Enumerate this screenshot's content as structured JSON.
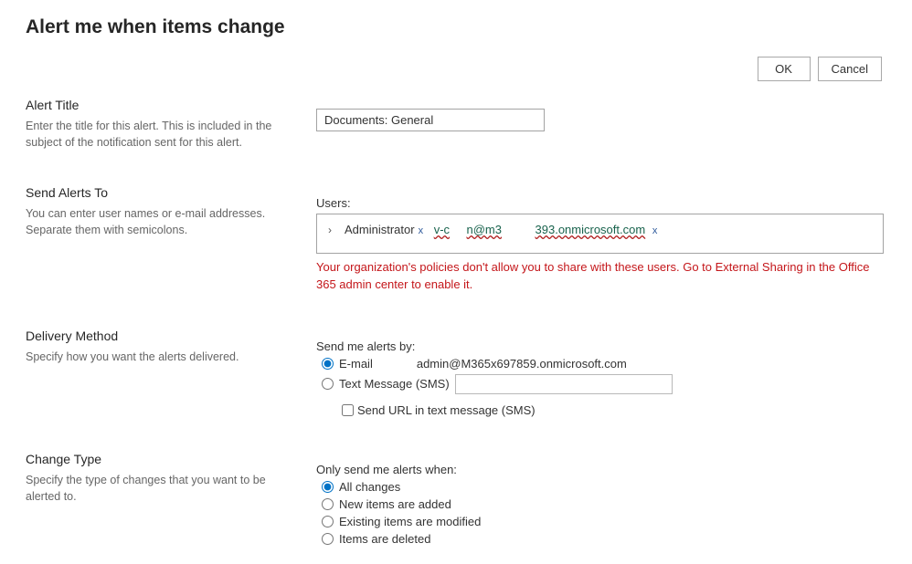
{
  "pageTitle": "Alert me when items change",
  "actions": {
    "ok": "OK",
    "cancel": "Cancel"
  },
  "alertTitle": {
    "heading": "Alert Title",
    "desc": "Enter the title for this alert. This is included in the subject of the notification sent for this alert.",
    "value": "Documents: General"
  },
  "sendAlertsTo": {
    "heading": "Send Alerts To",
    "desc": "You can enter user names or e-mail addresses. Separate them with semicolons.",
    "usersLabel": "Users:",
    "tokens": [
      {
        "text": "Administrator",
        "underlined": false
      },
      {
        "text": "v-c",
        "underlined": true
      },
      {
        "text": "n@m3",
        "underlined": true
      },
      {
        "text": "393.onmicrosoft.com",
        "underlined": true
      }
    ],
    "remove": "x",
    "error": "Your organization's policies don't allow you to share with these users. Go to External Sharing in the Office 365 admin center to enable it."
  },
  "delivery": {
    "heading": "Delivery Method",
    "desc": "Specify how you want the alerts delivered.",
    "sendByLabel": "Send me alerts by:",
    "emailLabel": "E-mail",
    "emailAddress": "admin@M365x697859.onmicrosoft.com",
    "smsLabel": "Text Message (SMS)",
    "smsValue": "",
    "sendUrlLabel": "Send URL in text message (SMS)"
  },
  "changeType": {
    "heading": "Change Type",
    "desc": "Specify the type of changes that you want to be alerted to.",
    "onlySendLabel": "Only send me alerts when:",
    "options": [
      "All changes",
      "New items are added",
      "Existing items are modified",
      "Items are deleted"
    ]
  }
}
